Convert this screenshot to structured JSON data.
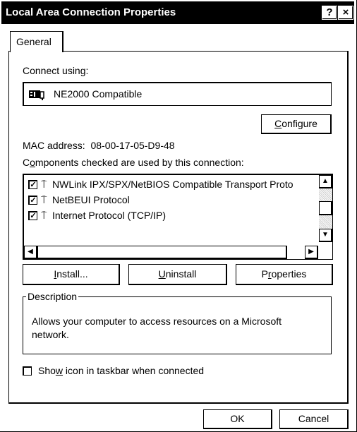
{
  "window": {
    "title": "Local Area Connection Properties",
    "help_label": "?",
    "close_label": "×"
  },
  "tabs": [
    {
      "label": "General"
    }
  ],
  "connect_using": {
    "label": "Connect using:",
    "adapter_name": "NE2000 Compatible",
    "adapter_icon": "network-card-icon"
  },
  "configure_button": {
    "label_prefix": "",
    "label_accel": "C",
    "label_rest": "onfigure"
  },
  "mac_address": {
    "label": "MAC address:",
    "value": "08-00-17-05-D9-48"
  },
  "components": {
    "label_prefix": "C",
    "label_accel": "o",
    "label_rest": "mponents checked are used by this connection:",
    "items": [
      {
        "label": "NWLink IPX/SPX/NetBIOS Compatible Transport Proto",
        "checked": true,
        "icon": "network-protocol-icon"
      },
      {
        "label": "NetBEUI Protocol",
        "checked": true,
        "icon": "network-protocol-icon"
      },
      {
        "label": "Internet Protocol (TCP/IP)",
        "checked": true,
        "icon": "network-protocol-icon"
      }
    ]
  },
  "buttons": {
    "install": {
      "accel": "I",
      "rest": "nstall..."
    },
    "uninstall": {
      "accel": "U",
      "rest": "ninstall"
    },
    "properties": {
      "pre": "P",
      "accel": "r",
      "rest": "operties"
    }
  },
  "description": {
    "legend": "Description",
    "text": "Allows your computer to access resources on a Microsoft network."
  },
  "show_icon": {
    "pre": "Sho",
    "accel": "w",
    "rest": " icon in taskbar when connected",
    "checked": false
  },
  "footer": {
    "ok_label": "OK",
    "cancel_label": "Cancel"
  }
}
